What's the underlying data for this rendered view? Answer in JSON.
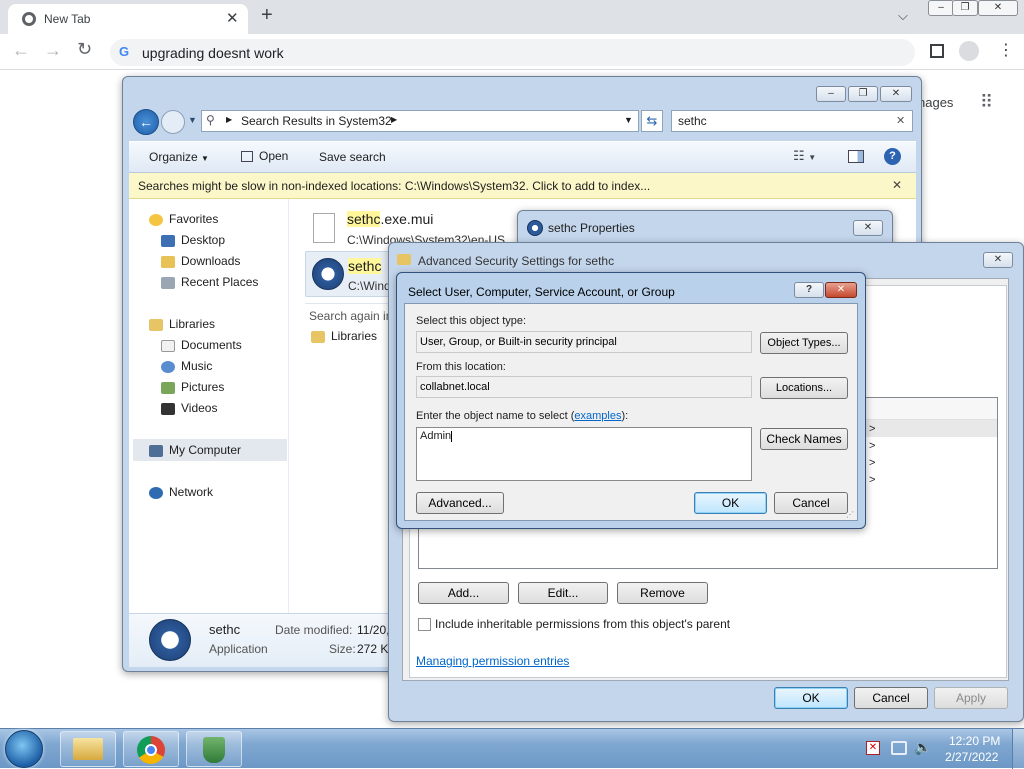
{
  "browser": {
    "tab_title": "New Tab",
    "omnibox_text": "upgrading doesnt work",
    "right_partial_text": "nages"
  },
  "explorer": {
    "breadcrumb_item": "Search Results in System32",
    "search_text": "sethc",
    "toolbar": {
      "organize": "Organize",
      "open": "Open",
      "save_search": "Save search"
    },
    "infobar": "Searches might be slow in non-indexed locations: C:\\Windows\\System32. Click to add to index...",
    "favorites": {
      "header": "Favorites",
      "items": [
        "Desktop",
        "Downloads",
        "Recent Places"
      ]
    },
    "libraries": {
      "header": "Libraries",
      "items": [
        "Documents",
        "Music",
        "Pictures",
        "Videos"
      ]
    },
    "computer": "My Computer",
    "network": "Network",
    "results": [
      {
        "name_hl": "sethc",
        "name_rest": ".exe.mui",
        "path": "C:\\Windows\\System32\\en-US"
      },
      {
        "name_hl": "sethc",
        "name_rest": "",
        "path": "C:\\Windc"
      }
    ],
    "search_again": "Search again in",
    "search_again_libraries": "Libraries",
    "details": {
      "name": "sethc",
      "type": "Application",
      "modified_label": "Date modified:",
      "modified_value": "11/20,",
      "size_label": "Size:",
      "size_value": "272 KE"
    }
  },
  "properties": {
    "title": "sethc Properties"
  },
  "advanced": {
    "title": "Advanced Security Settings for sethc",
    "buttons": {
      "add": "Add...",
      "edit": "Edit...",
      "remove": "Remove"
    },
    "checkbox_label": "Include inheritable permissions from this object's parent",
    "link": "Managing permission entries",
    "ok": "OK",
    "cancel": "Cancel",
    "apply": "Apply",
    "arrows": [
      ">",
      ">",
      ">",
      ">"
    ]
  },
  "select_dialog": {
    "title": "Select User, Computer, Service Account, or Group",
    "object_type_label": "Select this object type:",
    "object_type_value": "User, Group, or Built-in security principal",
    "object_types_button": "Object Types...",
    "location_label": "From this location:",
    "location_value": "collabnet.local",
    "locations_button": "Locations...",
    "enter_label_pre": "Enter the object name to select (",
    "enter_label_link": "examples",
    "enter_label_post": "):",
    "object_name": "Admin",
    "check_names_button": "Check Names",
    "advanced_button": "Advanced...",
    "ok": "OK",
    "cancel": "Cancel",
    "help": "?"
  },
  "taskbar": {
    "time": "12:20 PM",
    "date": "2/27/2022"
  },
  "colors": {
    "highlight": "#fff79a",
    "link": "#0066cc",
    "taskbar": "#7ea6d0"
  }
}
